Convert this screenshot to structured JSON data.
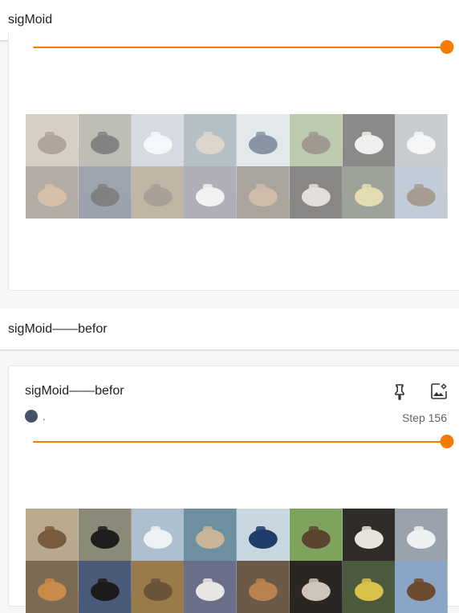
{
  "sections": [
    {
      "header": "sigMoid"
    },
    {
      "header": "sigMoid——befor"
    }
  ],
  "card_top": {
    "slider_value": 1.0
  },
  "card_bottom": {
    "title": "sigMoid——befor",
    "run_name": ".",
    "run_color": "#455368",
    "step_label": "Step 156",
    "slider_value": 1.0
  },
  "accent_color": "#f57c00",
  "icons": [
    "pin-icon",
    "image-settings-icon"
  ],
  "image_grid": {
    "columns": 8,
    "rows": 2,
    "tiles": [
      {
        "subject": "rider-on-horse",
        "bg": "#b8a98f",
        "fg": "#7a5a3c"
      },
      {
        "subject": "dog-black-white",
        "bg": "#8b8a78",
        "fg": "#1e1e1e"
      },
      {
        "subject": "boat-white",
        "bg": "#aebfd0",
        "fg": "#eef2f5"
      },
      {
        "subject": "airplane-on-water",
        "bg": "#6e8fa0",
        "fg": "#c9b59a"
      },
      {
        "subject": "ship-red-hull",
        "bg": "#c9d7e0",
        "fg": "#1f3d6a"
      },
      {
        "subject": "deer-in-field",
        "bg": "#7fa35d",
        "fg": "#5a4630"
      },
      {
        "subject": "horse-dark",
        "bg": "#2f2c29",
        "fg": "#e8e3dc"
      },
      {
        "subject": "airplane-small",
        "bg": "#9aa3ad",
        "fg": "#eef0f2"
      },
      {
        "subject": "cat-orange",
        "bg": "#7d6a55",
        "fg": "#c98a4a"
      },
      {
        "subject": "dog-black-white-2",
        "bg": "#4a5a78",
        "fg": "#1b1b1b"
      },
      {
        "subject": "cat-tabby",
        "bg": "#9a7a4a",
        "fg": "#6a5438"
      },
      {
        "subject": "white-bird",
        "bg": "#6a6f8a",
        "fg": "#e8e6e3"
      },
      {
        "subject": "dog-brown",
        "bg": "#6b5a48",
        "fg": "#b9834f"
      },
      {
        "subject": "dog-black-white-3",
        "bg": "#2a2624",
        "fg": "#cfc6bb"
      },
      {
        "subject": "car-yellow",
        "bg": "#4b5a3e",
        "fg": "#d8c24a"
      },
      {
        "subject": "horse-brown",
        "bg": "#8aa5c5",
        "fg": "#6b4a2e"
      }
    ]
  }
}
